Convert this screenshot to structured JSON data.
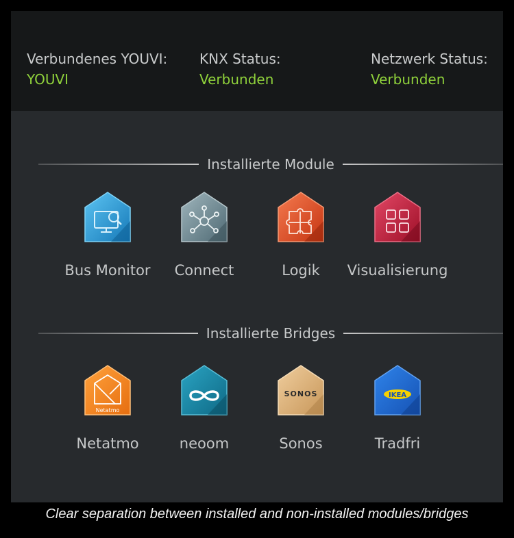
{
  "status": [
    {
      "label": "Verbundenes YOUVI:",
      "value": "YOUVI"
    },
    {
      "label": "KNX Status:",
      "value": "Verbunden"
    },
    {
      "label": "Netzwerk Status:",
      "value": "Verbunden"
    }
  ],
  "status_value_color": "#8fd13b",
  "modules": {
    "title": "Installierte Module",
    "items": [
      {
        "name": "Bus Monitor",
        "icon": "monitor-magnifier-icon",
        "color": "#2aa3df"
      },
      {
        "name": "Connect",
        "icon": "network-nodes-icon",
        "color": "#6f8a93"
      },
      {
        "name": "Logik",
        "icon": "puzzle-icon",
        "color": "#e4491f"
      },
      {
        "name": "Visualisierung",
        "icon": "grid-tiles-icon",
        "color": "#c61f3c"
      }
    ]
  },
  "bridges": {
    "title": "Installierte Bridges",
    "items": [
      {
        "name": "Netatmo",
        "icon": "netatmo-logo-icon",
        "color": "#f5871f",
        "logo_text": "Netatmo"
      },
      {
        "name": "neoom",
        "icon": "neoom-logo-icon",
        "color": "#1a86a6"
      },
      {
        "name": "Sonos",
        "icon": "sonos-logo-icon",
        "color": "#dfb680",
        "logo_text": "SONOS"
      },
      {
        "name": "Tradfri",
        "icon": "ikea-logo-icon",
        "color": "#1f6fd8",
        "logo_text": "IKEA"
      }
    ]
  },
  "caption": "Clear separation between installed and non-installed modules/bridges"
}
